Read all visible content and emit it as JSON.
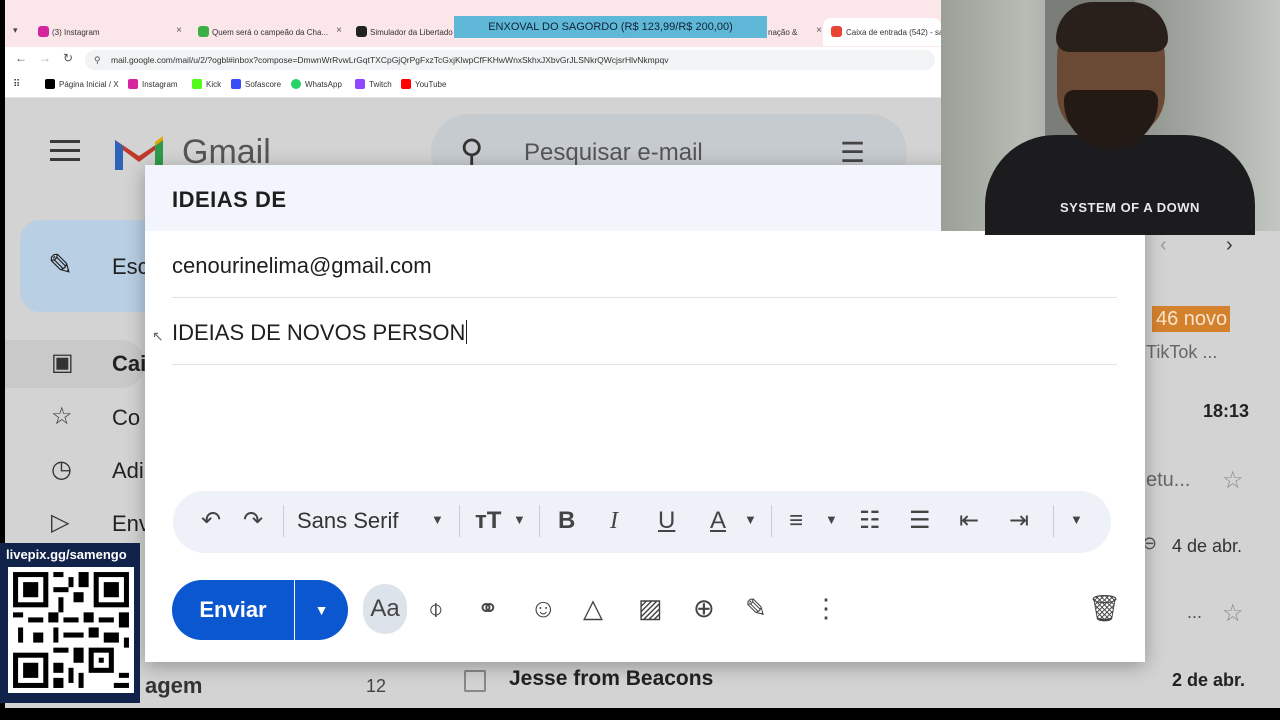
{
  "browser": {
    "tabs": [
      {
        "label": "(3) Instagram",
        "close": "×",
        "color": "#d6249f"
      },
      {
        "label": "Quem será o campeão da Cha...",
        "close": "×",
        "color": "#3cb043"
      },
      {
        "label": "Simulador da Libertado",
        "close": "",
        "color": "#222222"
      },
      {
        "label": "nação &",
        "close": "×",
        "color": "#888888"
      },
      {
        "label": "Caixa de entrada (542) - sa",
        "close": "",
        "color": "#ea4335"
      }
    ],
    "url": "mail.google.com/mail/u/2/?ogbl#inbox?compose=DmwnWrRvwLrGqtTXCpGjQrPgFxzTcGxjKlwpCfFKHwWnxSkhxJXbvGrJLSNkrQWcjsrHlvNkmpqv",
    "bookmarks": [
      {
        "label": "Página Inicial / X",
        "color": "#000000"
      },
      {
        "label": "Instagram",
        "color": "#d6249f"
      },
      {
        "label": "Kick",
        "color": "#53fc18"
      },
      {
        "label": "Sofascore",
        "color": "#374df5"
      },
      {
        "label": "WhatsApp",
        "color": "#25d366"
      },
      {
        "label": "Twitch",
        "color": "#9146ff"
      },
      {
        "label": "YouTube",
        "color": "#ff0000"
      }
    ]
  },
  "overlay": {
    "banner": "ENXOVAL DO SAGORDO (R$ 123,99/R$ 200,00)",
    "qr_label": "livepix.gg/samengo"
  },
  "gmail": {
    "logo_text": "Gmail",
    "search_placeholder": "Pesquisar e-mail",
    "compose_label": "Esc",
    "nav": {
      "inbox": "Cai",
      "starred": "Co",
      "snoozed": "Adi",
      "sent": "Env",
      "last": "agem",
      "last_count": "12"
    },
    "list": {
      "badge": "46 novo",
      "tiktok": "TikTok ...",
      "time1": "18:13",
      "snippet1": "etu...",
      "date1": "4 de abr.",
      "dots": "...",
      "jesse_sender": "Jesse from Beacons",
      "jesse_date": "2 de abr."
    }
  },
  "compose": {
    "title": "IDEIAS DE",
    "to": "cenourinelima@gmail.com",
    "subject": "IDEIAS DE NOVOS PERSON",
    "font": "Sans Serif",
    "send_label": "Enviar",
    "format_toggle": "Aa"
  },
  "webcam": {
    "shirt_text": "SYSTEM OF A DOWN"
  }
}
